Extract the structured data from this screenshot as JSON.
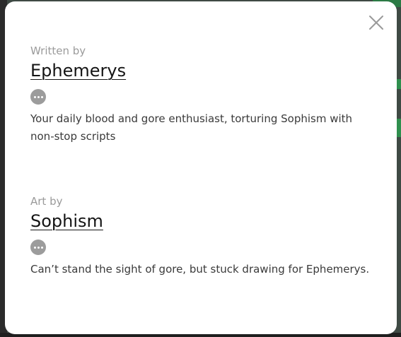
{
  "credits": {
    "writer": {
      "role": "Written by",
      "name": "Ephemerys",
      "bio": "Your daily blood and gore enthusiast, torturing Sophism with non-stop scripts"
    },
    "artist": {
      "role": "Art by",
      "name": "Sophism",
      "bio": "Can’t stand the sight of gore, but stuck drawing for Ephemerys."
    }
  },
  "icons": {
    "close": "close-icon",
    "more": "more-horizontal-icon"
  },
  "colors": {
    "modal_bg": "#ffffff",
    "role_text": "#9a9a9a",
    "name_text": "#141414",
    "bio_text": "#3a3a3a",
    "more_button": "#9c9c9c",
    "close_icon": "#9a9a9a"
  }
}
